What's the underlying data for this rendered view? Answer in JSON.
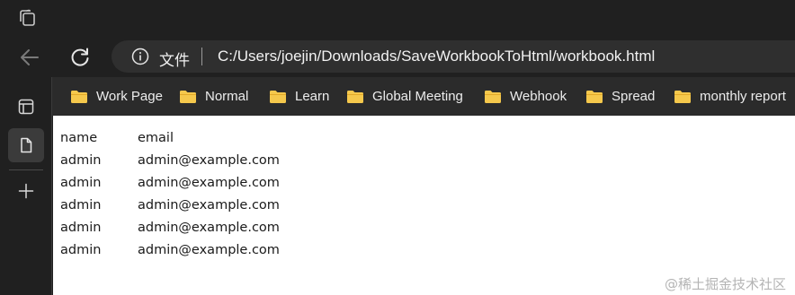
{
  "toolbar": {
    "back_icon": "back-arrow-icon",
    "refresh_icon": "refresh-icon"
  },
  "address_bar": {
    "label": "文件",
    "url": "C:/Users/joejin/Downloads/SaveWorkbookToHtml/workbook.html"
  },
  "bookmarks": [
    {
      "label": "Work Page"
    },
    {
      "label": "Normal"
    },
    {
      "label": "Learn"
    },
    {
      "label": "Global Meeting"
    },
    {
      "label": "Webhook"
    },
    {
      "label": "Spread"
    },
    {
      "label": "monthly report"
    }
  ],
  "sidebar": {
    "items": [
      "panel-icon",
      "page-icon",
      "add-icon"
    ]
  },
  "table": {
    "headers": [
      "name",
      "email"
    ],
    "rows": [
      [
        "admin",
        "admin@example.com"
      ],
      [
        "admin",
        "admin@example.com"
      ],
      [
        "admin",
        "admin@example.com"
      ],
      [
        "admin",
        "admin@example.com"
      ],
      [
        "admin",
        "admin@example.com"
      ]
    ]
  },
  "watermark": "@稀土掘金技术社区",
  "colors": {
    "chrome_bg": "#202020",
    "bookmarks_bg": "#2b2b2b",
    "folder": "#f5c84c",
    "page_bg": "#ffffff"
  }
}
